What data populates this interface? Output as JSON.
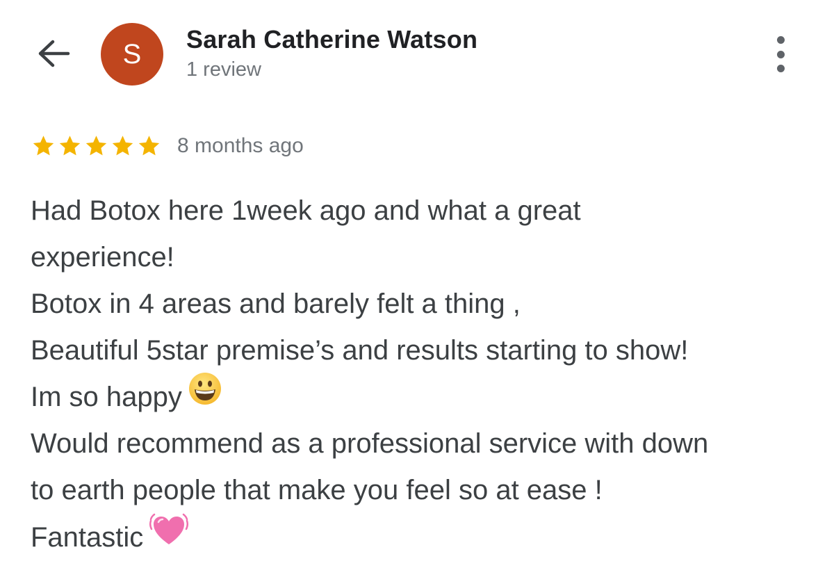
{
  "header": {
    "back_icon": "arrow-left-icon",
    "avatar_letter": "S",
    "avatar_color": "#c0461e",
    "author_name": "Sarah Catherine Watson",
    "review_count": "1 review",
    "more_icon": "more-vertical-icon"
  },
  "review": {
    "rating": 5,
    "rating_max": 5,
    "star_color": "#f4b400",
    "date": "8 months ago",
    "lines": [
      {
        "text": "Had Botox here 1week ago and what a great"
      },
      {
        "text": "experience!"
      },
      {
        "text": "Botox in 4 areas and barely felt a thing ,"
      },
      {
        "text": "Beautiful 5star premise’s and results starting to show!"
      },
      {
        "text": "Im so happy",
        "emoji": "grinning-face-icon"
      },
      {
        "text": "Would recommend as a professional service with down"
      },
      {
        "text": "to earth people that make you feel so at ease !"
      },
      {
        "text": "Fantastic",
        "emoji": "beating-heart-icon"
      }
    ]
  }
}
